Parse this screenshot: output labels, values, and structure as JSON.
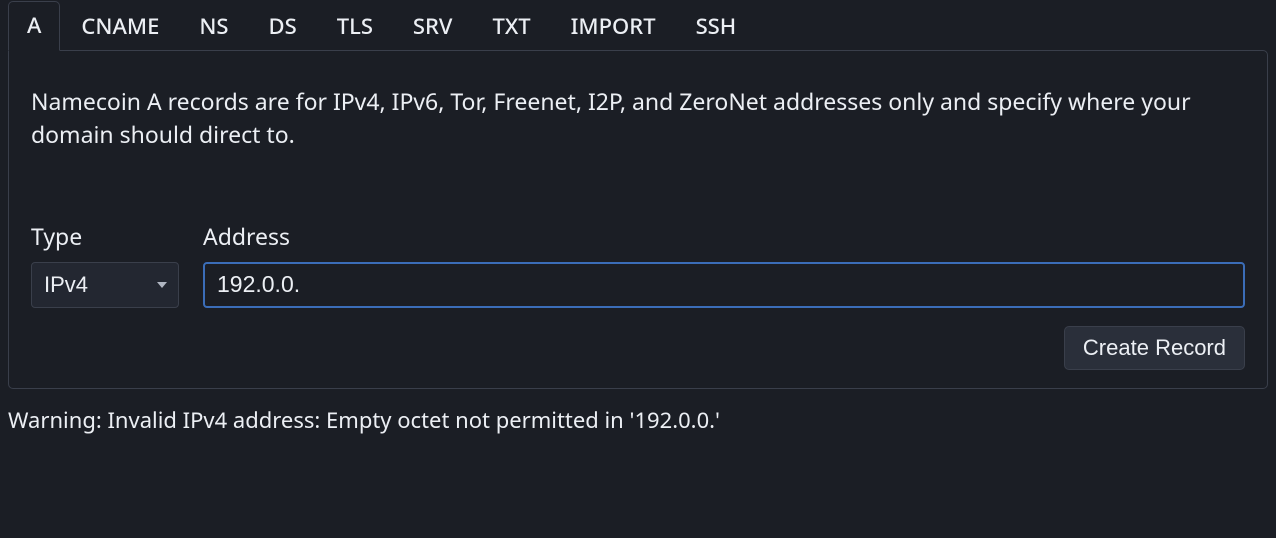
{
  "tabs": [
    {
      "label": "A",
      "active": true
    },
    {
      "label": "CNAME",
      "active": false
    },
    {
      "label": "NS",
      "active": false
    },
    {
      "label": "DS",
      "active": false
    },
    {
      "label": "TLS",
      "active": false
    },
    {
      "label": "SRV",
      "active": false
    },
    {
      "label": "TXT",
      "active": false
    },
    {
      "label": "IMPORT",
      "active": false
    },
    {
      "label": "SSH",
      "active": false
    }
  ],
  "panel": {
    "description": "Namecoin A records are for IPv4, IPv6, Tor, Freenet, I2P, and ZeroNet addresses only and specify where your domain should direct to.",
    "type_label": "Type",
    "address_label": "Address",
    "type_value": "IPv4",
    "address_value": "192.0.0.",
    "create_label": "Create Record"
  },
  "status": "Warning: Invalid IPv4 address: Empty octet not permitted in '192.0.0.'"
}
